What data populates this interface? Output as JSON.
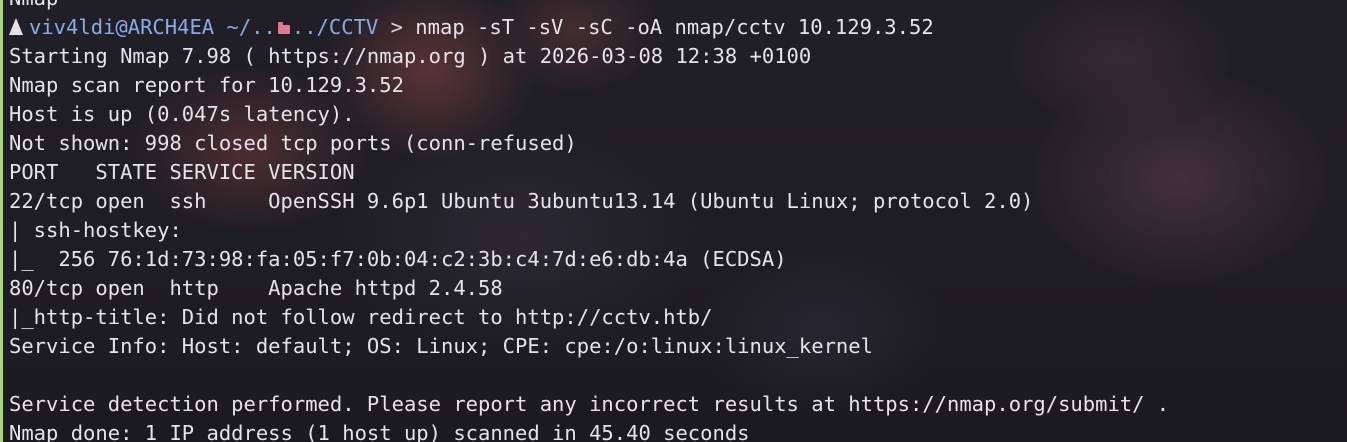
{
  "terminal": {
    "partial_top_line": "Nmap",
    "prompt": {
      "user_host": "viv4ldi@ARCH4EA",
      "path_home": " ~/",
      "path_dots": "..",
      "path_rest": "../CCTV",
      "arrow": " > ",
      "command": "nmap -sT -sV -sC -oA nmap/cctv 10.129.3.52",
      "os_icon": "arch-linux-icon",
      "folder_icon": "folder-icon"
    },
    "output": [
      "Starting Nmap 7.98 ( https://nmap.org ) at 2026-03-08 12:38 +0100",
      "Nmap scan report for 10.129.3.52",
      "Host is up (0.047s latency).",
      "Not shown: 998 closed tcp ports (conn-refused)",
      "PORT   STATE SERVICE VERSION",
      "22/tcp open  ssh     OpenSSH 9.6p1 Ubuntu 3ubuntu13.14 (Ubuntu Linux; protocol 2.0)",
      "| ssh-hostkey:",
      "|_  256 76:1d:73:98:fa:05:f7:0b:04:c2:3b:c4:7d:e6:db:4a (ECDSA)",
      "80/tcp open  http    Apache httpd 2.4.58",
      "|_http-title: Did not follow redirect to http://cctv.htb/",
      "Service Info: Host: default; OS: Linux; CPE: cpe:/o:linux:linux_kernel",
      "",
      "Service detection performed. Please report any incorrect results at https://nmap.org/submit/ .",
      "Nmap done: 1 IP address (1 host up) scanned in 45.40 seconds"
    ]
  },
  "colors": {
    "prompt_blue": "#8aa9e8",
    "folder_pink": "#e07a8f",
    "text": "#e6e2ea",
    "focus_border": "#a3d97a",
    "background": "#1d1c22"
  }
}
